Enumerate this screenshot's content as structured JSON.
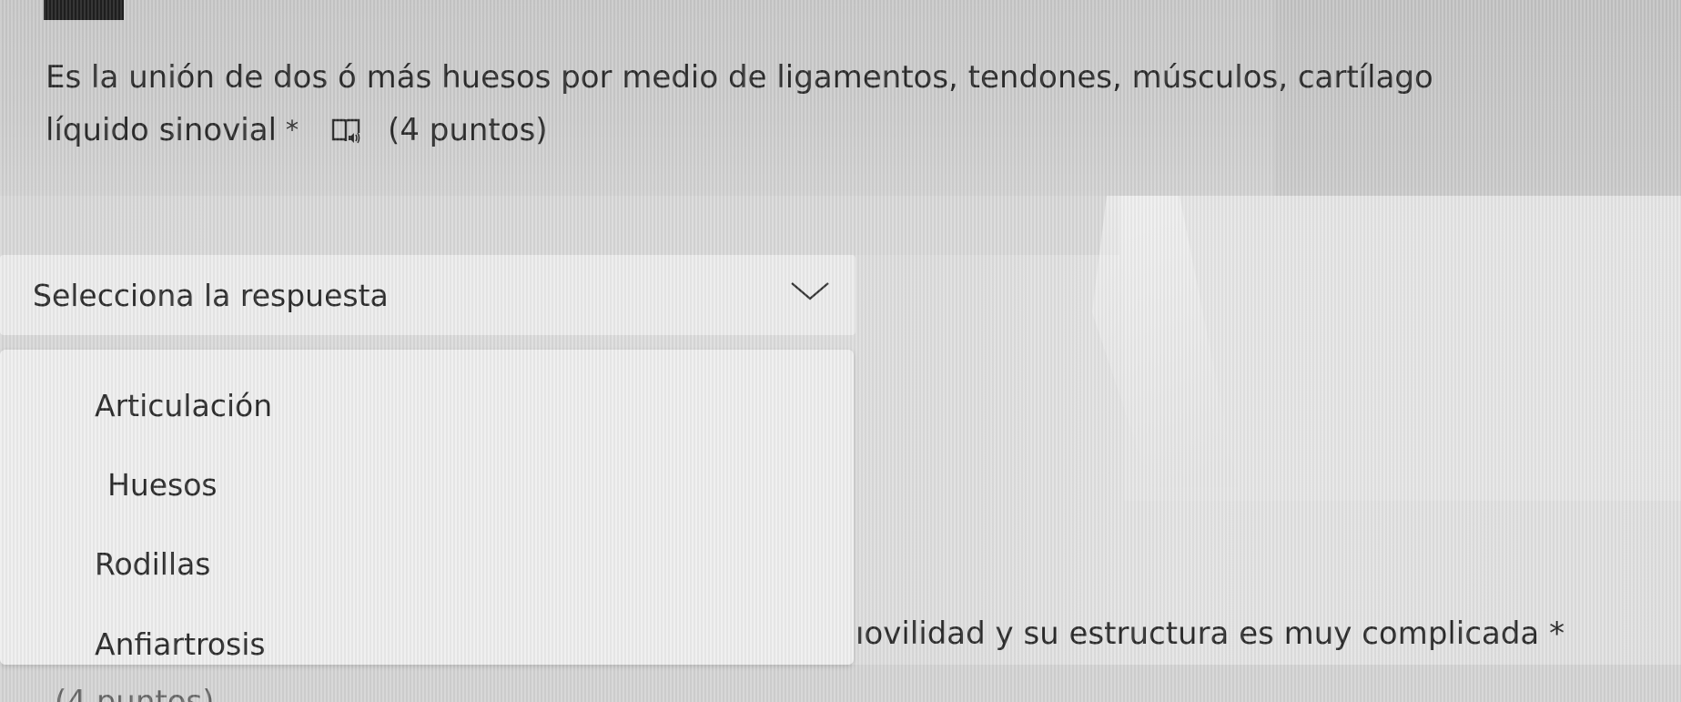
{
  "question": {
    "line1": "Es la unión de dos ó más huesos por medio de ligamentos, tendones, músculos, cartílago",
    "line2": "líquido sinovial",
    "required_mark": "*",
    "reader_icon": "immersive-reader-icon",
    "points": "(4 puntos)"
  },
  "select": {
    "placeholder": "Selecciona la respuesta",
    "chevron_icon": "chevron-down-icon"
  },
  "dropdown": {
    "options": [
      {
        "label": "Articulación"
      },
      {
        "label": "Huesos"
      },
      {
        "label": "Rodillas"
      },
      {
        "label": "Anfiartrosis"
      }
    ]
  },
  "background_question": {
    "partial_text": "ıovilidad y su estructura es muy complicada *",
    "partial_points": "(4 puntos)"
  },
  "colors": {
    "text": "#2a2a2a",
    "dropdown_bg": "#eeeeee",
    "page_bg": "#cfcfcf"
  }
}
